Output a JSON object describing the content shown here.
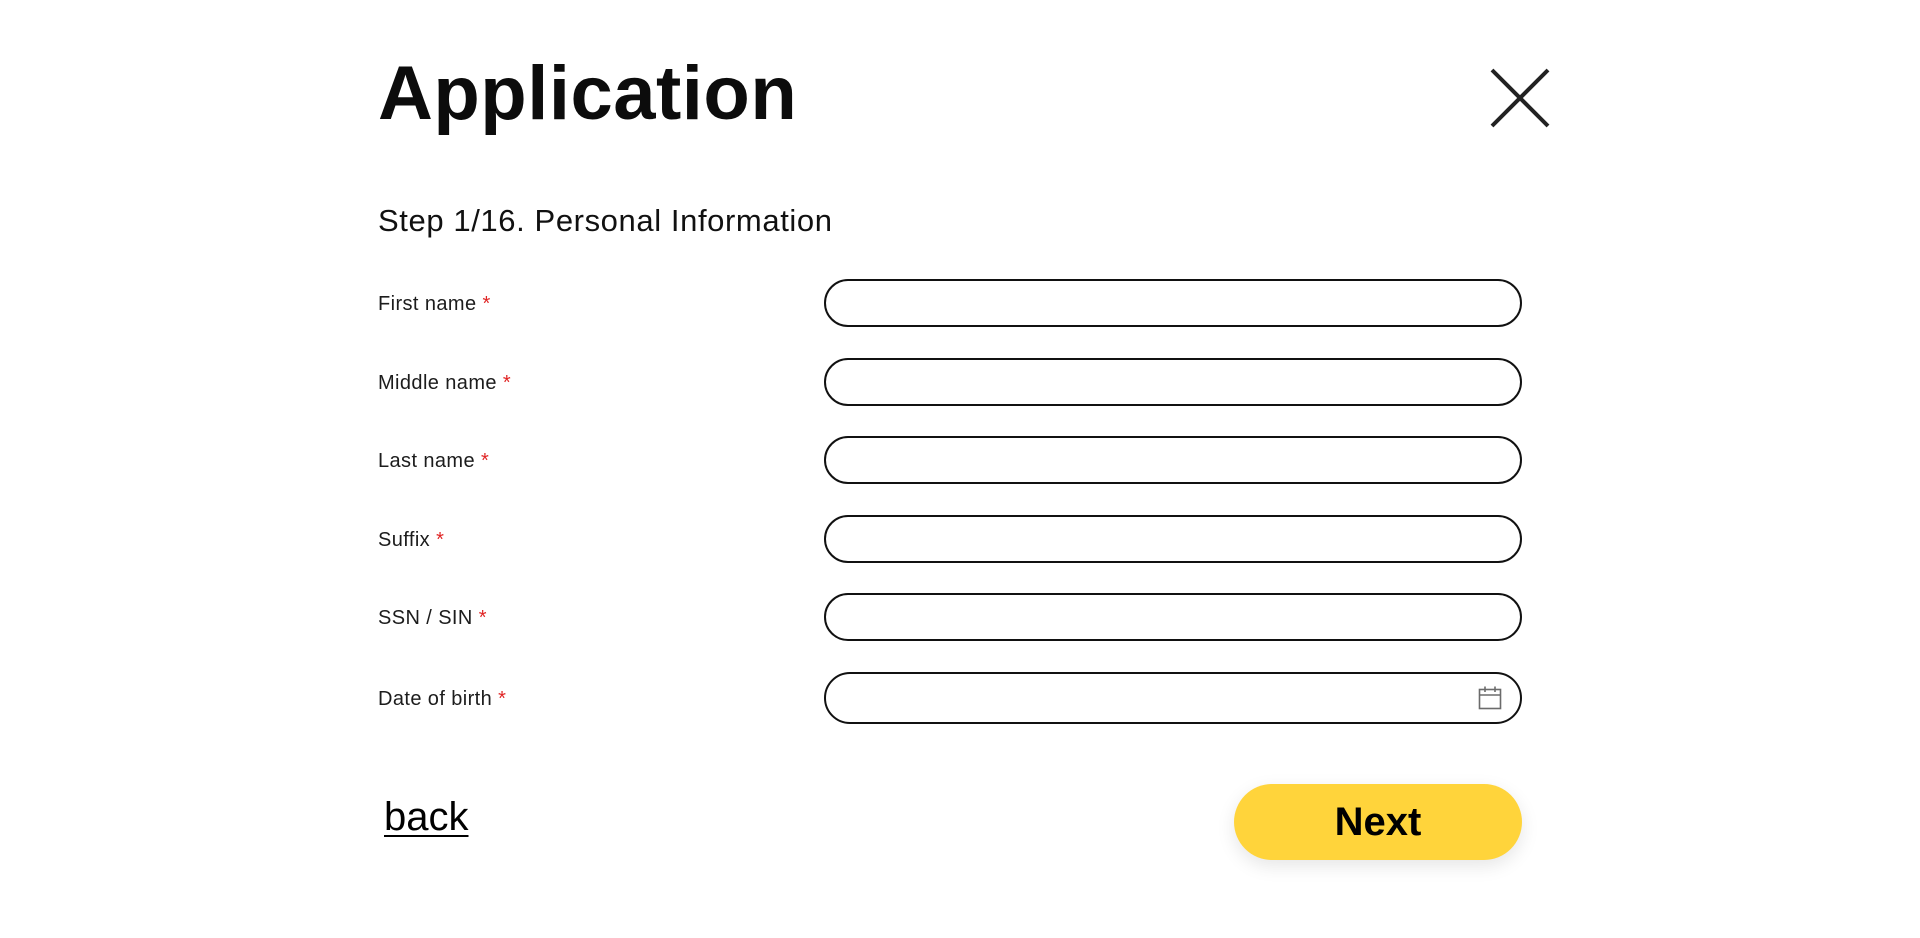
{
  "header": {
    "title": "Application",
    "close_icon": "close-icon"
  },
  "step": {
    "title": "Step 1/16. Personal Information"
  },
  "form": {
    "required_marker": "*",
    "fields": [
      {
        "label": "First name",
        "value": "",
        "placeholder": ""
      },
      {
        "label": "Middle name",
        "value": "",
        "placeholder": ""
      },
      {
        "label": "Last name",
        "value": "",
        "placeholder": ""
      },
      {
        "label": "Suffix",
        "value": "",
        "placeholder": ""
      },
      {
        "label": "SSN / SIN",
        "value": "",
        "placeholder": ""
      },
      {
        "label": "Date of birth",
        "value": "",
        "placeholder": "",
        "icon": "calendar-icon"
      }
    ]
  },
  "footer": {
    "back_label": "back",
    "next_label": "Next"
  },
  "colors": {
    "accent": "#ffd43b",
    "required": "#e02424",
    "text": "#111111",
    "border": "#111111"
  }
}
